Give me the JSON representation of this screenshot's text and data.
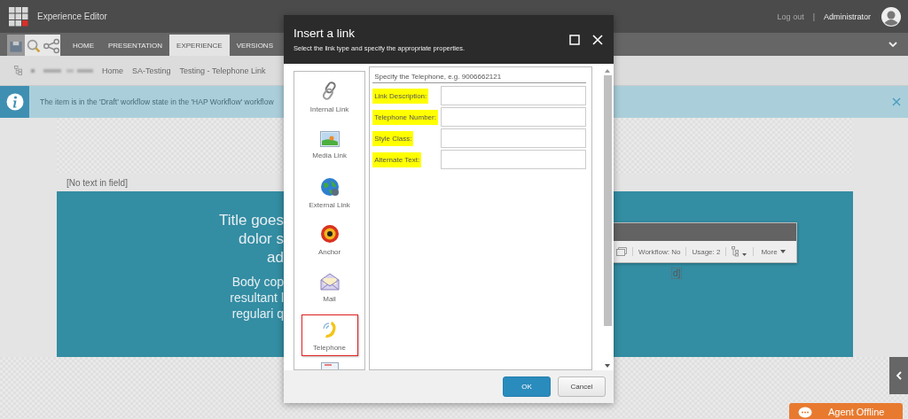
{
  "app_bar": {
    "title": "Experience Editor",
    "logout": "Log out",
    "separator": "|",
    "user": "Administrator"
  },
  "ribbon": {
    "tabs": [
      {
        "label": "HOME",
        "selected": false
      },
      {
        "label": "PRESENTATION",
        "selected": false
      },
      {
        "label": "EXPERIENCE",
        "selected": true
      },
      {
        "label": "VERSIONS",
        "selected": false
      }
    ]
  },
  "breadcrumb": [
    "Home",
    "SA-Testing",
    "Testing - Telephone Link"
  ],
  "notification": {
    "text": "The item is in the 'Draft' workflow state in the 'HAP Workflow' workflow"
  },
  "page": {
    "empty_field": "[No text in field]",
    "hero_title": [
      "Title goes",
      "dolor s",
      "ad"
    ],
    "hero_body": [
      "Body cop",
      "resultant l",
      "regulari q"
    ],
    "field_fragment": "d]"
  },
  "floating_toolbar": {
    "items": [
      "Workflow: No",
      "Usage: 2"
    ],
    "more": "More"
  },
  "dialog": {
    "title": "Insert a link",
    "subtitle": "Select the link type and specify the appropriate properties.",
    "link_types": [
      {
        "kind": "internal",
        "label": "Internal Link",
        "selected": false
      },
      {
        "kind": "media",
        "label": "Media Link",
        "selected": false
      },
      {
        "kind": "external",
        "label": "External Link",
        "selected": false
      },
      {
        "kind": "anchor",
        "label": "Anchor",
        "selected": false
      },
      {
        "kind": "mail",
        "label": "Mail",
        "selected": false
      },
      {
        "kind": "telephone",
        "label": "Telephone",
        "selected": true
      }
    ],
    "form_heading": "Specify the Telephone, e.g. 9006662121",
    "fields": [
      {
        "label": "Link Description:",
        "highlighted": true
      },
      {
        "label": "Telephone Number:",
        "highlighted": true
      },
      {
        "label": "Style Class:",
        "highlighted": true
      },
      {
        "label": "Alternate Text:",
        "highlighted": true
      }
    ],
    "buttons": [
      {
        "kind": "primary",
        "label": "OK"
      },
      {
        "kind": "secondary",
        "label": "Cancel"
      }
    ]
  },
  "chat_button": {
    "label": "Agent Offline"
  }
}
